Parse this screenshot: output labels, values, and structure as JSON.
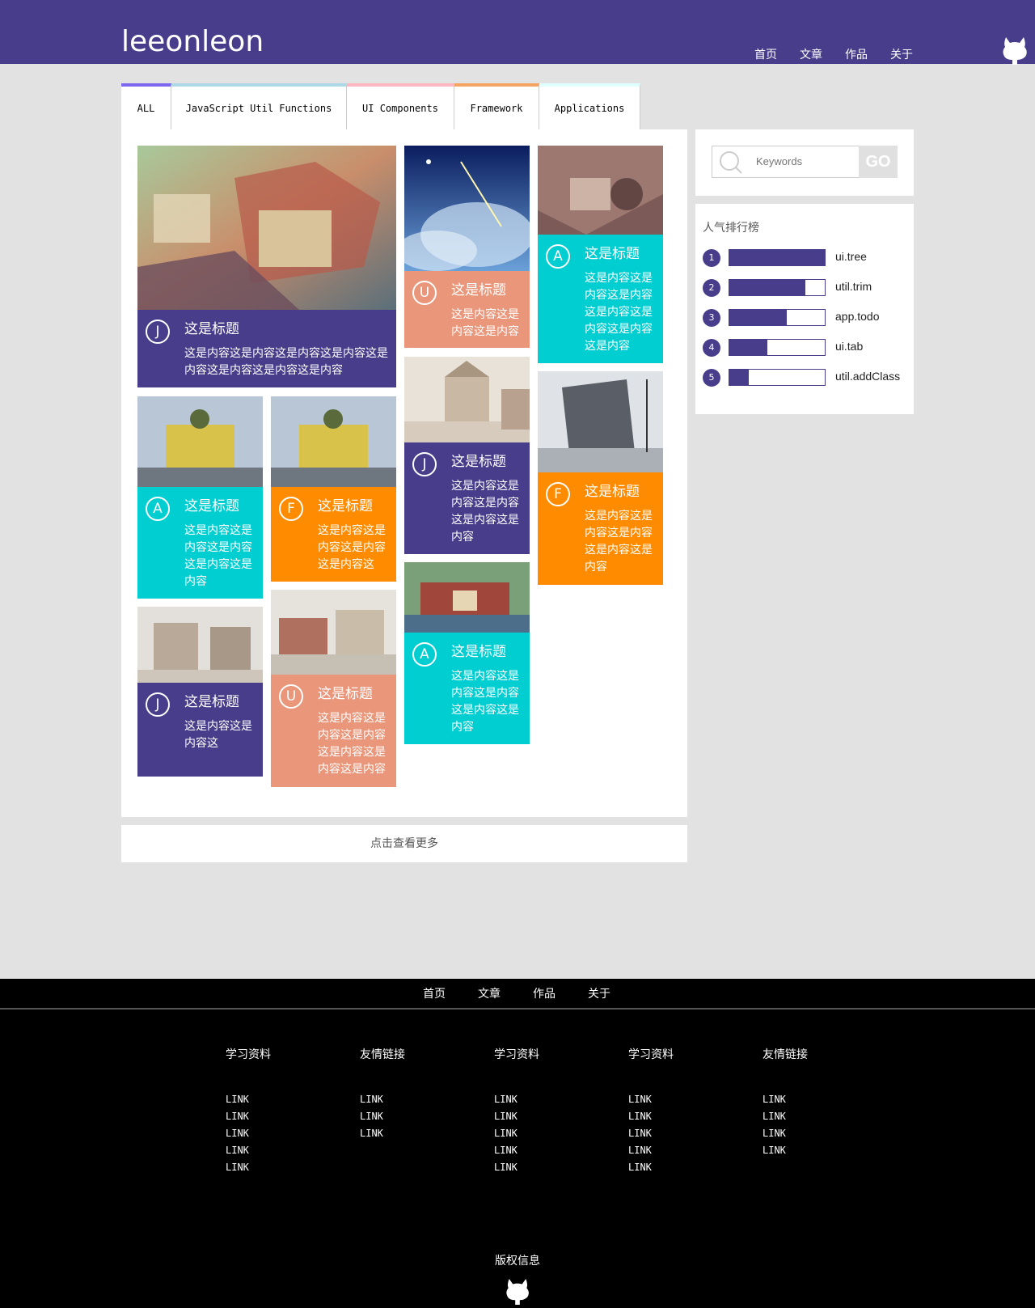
{
  "header": {
    "logo": "leeonleon",
    "nav": [
      "首页",
      "文章",
      "作品",
      "关于"
    ]
  },
  "tabs": [
    {
      "label": "ALL",
      "color": "#7b68ee"
    },
    {
      "label": "JavaScript Util Functions",
      "color": "#add8e6"
    },
    {
      "label": "UI Components",
      "color": "#ffb6c1"
    },
    {
      "label": "Framework",
      "color": "#f4a460"
    },
    {
      "label": "Applications",
      "color": "#e0ffff"
    }
  ],
  "cards": [
    {
      "badge": "J",
      "title": "这是标题",
      "desc": "这是内容这是内容这是内容这是内容这是内容这是内容这是内容这是内容",
      "color": "purple"
    },
    {
      "badge": "U",
      "title": "这是标题",
      "desc": "这是内容这是内容这是内容",
      "color": "salmon"
    },
    {
      "badge": "A",
      "title": "这是标题",
      "desc": "这是内容这是内容这是内容这是内容这是内容这是内容这是内容",
      "color": "cyan"
    },
    {
      "badge": "J",
      "title": "这是标题",
      "desc": "这是内容这是内容这是内容这是内容这是内容",
      "color": "purple"
    },
    {
      "badge": "F",
      "title": "这是标题",
      "desc": "这是内容这是内容这是内容这是内容这是内容",
      "color": "orange"
    },
    {
      "badge": "A",
      "title": "这是标题",
      "desc": "这是内容这是内容这是内容这是内容这是内容",
      "color": "cyan"
    },
    {
      "badge": "F",
      "title": "这是标题",
      "desc": "这是内容这是内容这是内容这是内容这",
      "color": "orange"
    },
    {
      "badge": "A",
      "title": "这是标题",
      "desc": "这是内容这是内容这是内容这是内容这是内容",
      "color": "cyan"
    },
    {
      "badge": "J",
      "title": "这是标题",
      "desc": "这是内容这是内容这",
      "color": "purple"
    },
    {
      "badge": "U",
      "title": "这是标题",
      "desc": "这是内容这是内容这是内容这是内容这是内容这是内容",
      "color": "salmon"
    }
  ],
  "more_label": "点击查看更多",
  "search": {
    "placeholder": "Keywords",
    "go": "GO"
  },
  "ranking": {
    "title": "人气排行榜",
    "items": [
      {
        "rank": "1",
        "label": "ui.tree",
        "level": 1.0
      },
      {
        "rank": "2",
        "label": "util.trim",
        "level": 0.8
      },
      {
        "rank": "3",
        "label": "app.todo",
        "level": 0.6
      },
      {
        "rank": "4",
        "label": "ui.tab",
        "level": 0.4
      },
      {
        "rank": "5",
        "label": "util.addClass",
        "level": 0.2
      }
    ]
  },
  "footer": {
    "nav": [
      "首页",
      "文章",
      "作品",
      "关于"
    ],
    "columns": [
      {
        "heading": "学习资料",
        "links": [
          "LINK",
          "LINK",
          "LINK",
          "LINK",
          "LINK"
        ]
      },
      {
        "heading": "友情链接",
        "links": [
          "LINK",
          "LINK",
          "LINK"
        ]
      },
      {
        "heading": "学习资料",
        "links": [
          "LINK",
          "LINK",
          "LINK",
          "LINK",
          "LINK"
        ]
      },
      {
        "heading": "学习资料",
        "links": [
          "LINK",
          "LINK",
          "LINK",
          "LINK",
          "LINK"
        ]
      },
      {
        "heading": "友情链接",
        "links": [
          "LINK",
          "LINK",
          "LINK",
          "LINK"
        ]
      }
    ],
    "copyright": "版权信息"
  }
}
